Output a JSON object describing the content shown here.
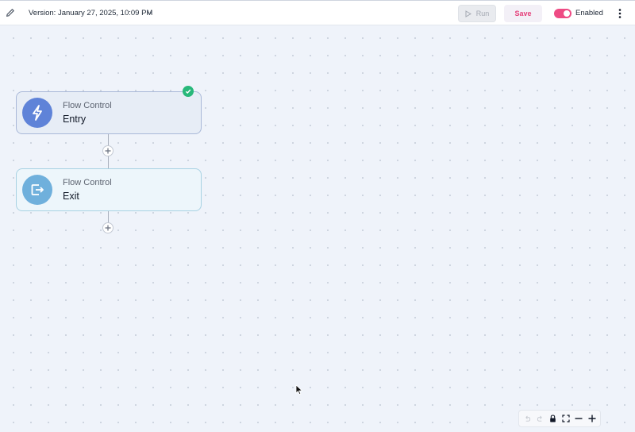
{
  "toolbar": {
    "edit_icon": "pencil-icon",
    "version_label": "Version: January 27, 2025, 10:09 PM",
    "run_label": "Run",
    "save_label": "Save",
    "enabled_label": "Enabled",
    "enabled": true,
    "accent_color": "#ee4b84"
  },
  "nodes": [
    {
      "kind": "Flow Control",
      "title": "Entry",
      "icon": "lightning-bolt-icon",
      "icon_color": "#5f83d8",
      "status": "success"
    },
    {
      "kind": "Flow Control",
      "title": "Exit",
      "icon": "exit-icon",
      "icon_color": "#6fb0dc"
    }
  ],
  "controls": [
    "undo-icon",
    "redo-icon",
    "lock-icon",
    "fit-view-icon",
    "zoom-out-icon",
    "zoom-in-icon"
  ]
}
